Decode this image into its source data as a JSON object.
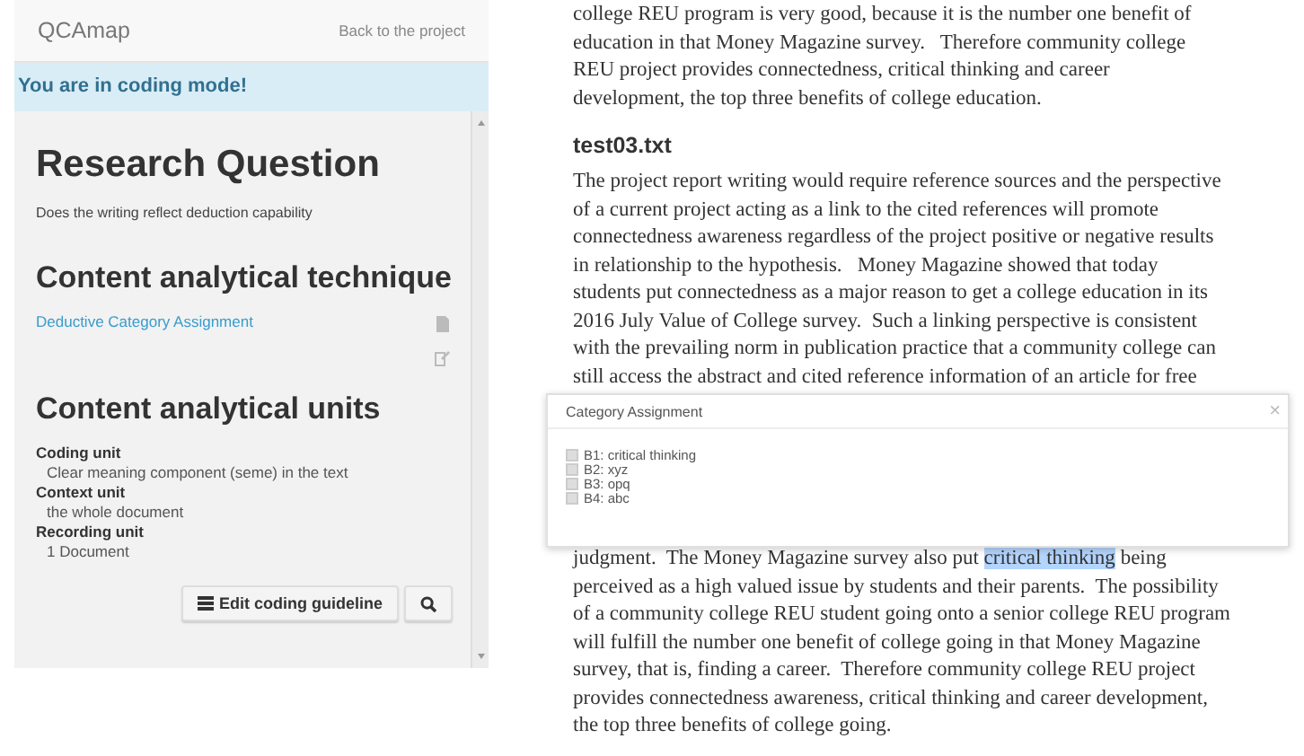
{
  "sidebar": {
    "brand": "QCAmap",
    "back_link": "Back to the project",
    "notice": "You are in coding mode!",
    "sections": [
      {
        "kind": "question",
        "heading": "Research Question",
        "text": "Does the writing reflect deduction capability"
      },
      {
        "kind": "technique",
        "heading": "Content analytical technique",
        "link": "Deductive Category Assignment"
      },
      {
        "kind": "units",
        "heading": "Content analytical units",
        "units": [
          {
            "label": "Coding unit",
            "value": "Clear meaning component (seme) in the text"
          },
          {
            "label": "Context unit",
            "value": "the whole document"
          },
          {
            "label": "Recording unit",
            "value": "1 Document"
          }
        ]
      }
    ],
    "buttons": [
      {
        "kind": "guideline",
        "label": "Edit coding guideline"
      },
      {
        "kind": "search"
      }
    ]
  },
  "document": {
    "blocks": [
      {
        "kind": "paragraph",
        "lines": [
          "college REU program is very good, because it is the number one benefit of",
          "education in that Money Magazine survey.   Therefore community college",
          "REU project provides connectedness, critical thinking and career",
          "development, the top three benefits of college education."
        ]
      },
      {
        "kind": "heading",
        "text": "test03.txt"
      },
      {
        "kind": "paragraph",
        "lines": [
          "The project report writing would require reference sources and the perspective",
          "of a current project acting as a link to the cited references will promote",
          "connectedness awareness regardless of the project positive or negative results",
          "in relationship to the hypothesis.   Money Magazine showed that today",
          "students put connectedness as a major reason to get a college education in its",
          "2016 July Value of College survey.  Such a linking perspective is consistent",
          "with the prevailing norm in publication practice that a community college can",
          "still access the abstract and cited reference information of an article for free"
        ]
      },
      {
        "kind": "continuation",
        "lines": [
          {
            "before": "judgment.  The Money Magazine survey also put",
            "highlight": "critical thinking",
            "after": "being"
          },
          "perceived as a high valued issue by students and their parents.  The possibility",
          "of a community college REU student going onto a senior college REU program",
          "will fulfill the number one benefit of college going in that Money Magazine",
          "survey, that is, finding a career.  Therefore community college REU project",
          "provides connectedness awareness, critical thinking and career development,",
          "the top three benefits of college going."
        ]
      }
    ]
  },
  "dialog": {
    "title": "Category Assignment",
    "close": "×",
    "categories": [
      {
        "label": "B1: critical thinking",
        "checked": false
      },
      {
        "label": "B2: xyz",
        "checked": false
      },
      {
        "label": "B3: opq",
        "checked": false
      },
      {
        "label": "B4: abc",
        "checked": false
      }
    ]
  }
}
